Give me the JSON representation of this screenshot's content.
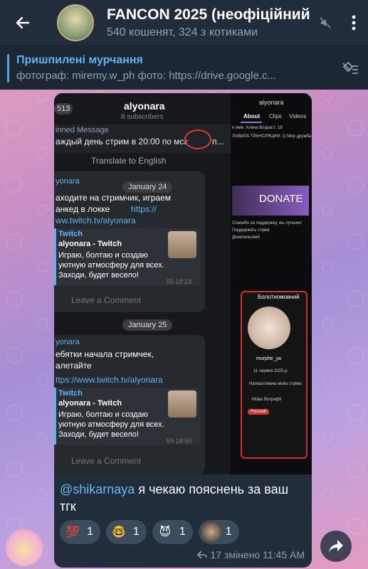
{
  "header": {
    "title": "FANCON 2025 (неофіційний",
    "subtitle": "540 кошенят, 324 з котиками"
  },
  "pinned": {
    "title": "Пришпилені мурчання",
    "body": "фотограф: miremy.w_ph  фото: https://drive.google.c..."
  },
  "screenshot": {
    "left": {
      "channel_name": "alyonara",
      "subscribers": "8 subscribers",
      "badge_count": "513",
      "pinned_label": "inned Message",
      "pinned_text": "аждый день стрим в 20:00 по мск",
      "pinned_suffix": "п...",
      "translate": "Translate to English",
      "date1": "January 24",
      "msg1_sender": "yonara",
      "msg1_text_line1": "аходите на стримчик, играем",
      "msg1_text_line2": "анкед в локке",
      "msg1_link": "https://",
      "msg1_url": "ww.twitch.tv/alyonara",
      "preview_site": "Twitch",
      "preview_title": "alyonara - Twitch",
      "preview_line1": "Играю, болтаю и создаю",
      "preview_line2": "уютную атмосферу для всех.",
      "preview_line3": "Заходи, будет весело!",
      "msg1_meta": "55 18:23",
      "comment_label": "Leave a Comment",
      "date2": "January 25",
      "msg2_sender": "yonara",
      "msg2_text_line1": "ебятки начала стримчек,",
      "msg2_text_line2": "алетайте",
      "msg2_url": "ttps://www.twitch.tv/alyonara",
      "msg2_meta": "59 18:50"
    },
    "right": {
      "channel_name": "alyonara",
      "tabs": [
        "About",
        "Clips",
        "Videos"
      ],
      "about_line1": "е имя: Алена  Возраст: 18",
      "about_line2": "ЛАВИЛА ТРАНСЛЯЦИИ: 1) Мир дружба",
      "donate_label": "DONATE",
      "donate_line1": "Спасибо за поддержку, вы лучшие!",
      "donate_line2": "Поддержать стрим",
      "donate_line3": "Донательский",
      "card_name": "Болотномовний",
      "card_user": "morphe_ya",
      "card_date": "11 червня 2025 р.",
      "card_lang_label": "Налаштована мова стріма",
      "card_bio_label": "Мова біографії",
      "card_badge": "Русский"
    }
  },
  "caption": {
    "mention": "@shikarnaya",
    "text": " я чекаю пояснень за ваш тгк"
  },
  "reactions": [
    {
      "emoji": "💯",
      "count": "1"
    },
    {
      "emoji": "🤓",
      "count": "1"
    },
    {
      "emoji": "😈",
      "count": "1"
    },
    {
      "emoji": "",
      "count": "1"
    }
  ],
  "meta": {
    "replies": "17",
    "edited_time": "змінено 11:45 AM"
  },
  "colors": {
    "header_bg": "#212d3b",
    "accent": "#4ea4f6",
    "bubble_bg": "#212d3b"
  }
}
